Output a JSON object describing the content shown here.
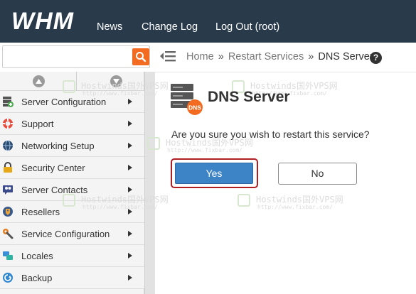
{
  "app": {
    "logo_text": "WHM",
    "nav": {
      "news": "News",
      "change_log": "Change Log",
      "logout": "Log Out (root)"
    }
  },
  "search": {
    "value": "",
    "placeholder": ""
  },
  "breadcrumb": {
    "home": "Home",
    "parent": "Restart Services",
    "current": "DNS Server",
    "separator": "»"
  },
  "help": {
    "symbol": "?"
  },
  "sidebar": {
    "items": [
      {
        "label": "Server Configuration",
        "icon": "server-config-icon"
      },
      {
        "label": "Support",
        "icon": "lifebuoy-icon"
      },
      {
        "label": "Networking Setup",
        "icon": "globe-icon"
      },
      {
        "label": "Security Center",
        "icon": "lock-icon"
      },
      {
        "label": "Server Contacts",
        "icon": "contacts-icon"
      },
      {
        "label": "Resellers",
        "icon": "reseller-tag-icon"
      },
      {
        "label": "Service Configuration",
        "icon": "wrench-icon"
      },
      {
        "label": "Locales",
        "icon": "locales-icon"
      },
      {
        "label": "Backup",
        "icon": "backup-icon"
      }
    ]
  },
  "main": {
    "title": "DNS Server",
    "icon_badge": "DNS",
    "confirm_text": "Are you sure you wish to restart this service?",
    "yes_label": "Yes",
    "no_label": "No"
  },
  "watermark": {
    "main": "Hostwinds国外VPS网",
    "sub": "http://www.fixbar.com/"
  },
  "colors": {
    "header_bg": "#293a4a",
    "accent_orange": "#f26b21",
    "primary_button": "#3d84c6",
    "highlight_outline": "#b01e24"
  }
}
